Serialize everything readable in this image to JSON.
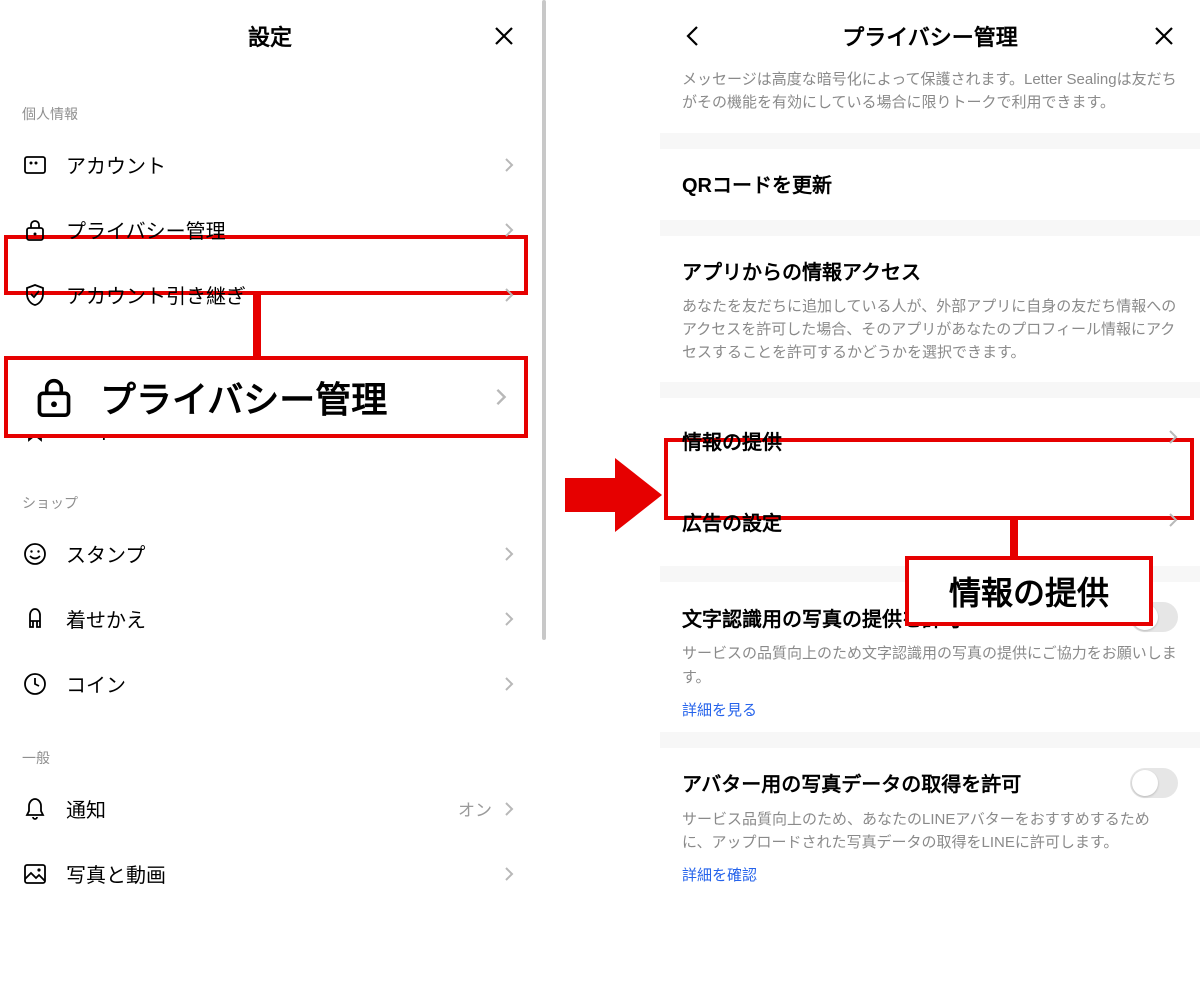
{
  "left": {
    "title": "設定",
    "sections": [
      {
        "label": "個人情報",
        "items": [
          {
            "icon": "account",
            "label": "アカウント"
          },
          {
            "icon": "lock",
            "label": "プライバシー管理"
          },
          {
            "icon": "shield",
            "label": "アカウント引き継ぎ"
          }
        ]
      }
    ],
    "callout": "プライバシー管理",
    "keep_label": "Keep",
    "shop_section": "ショップ",
    "shop_items": [
      {
        "icon": "smiley",
        "label": "スタンプ"
      },
      {
        "icon": "theme",
        "label": "着せかえ"
      },
      {
        "icon": "coin",
        "label": "コイン"
      }
    ],
    "general_section": "一般",
    "general_items": [
      {
        "icon": "bell",
        "label": "通知",
        "value": "オン"
      },
      {
        "icon": "photo",
        "label": "写真と動画"
      }
    ]
  },
  "right": {
    "title": "プライバシー管理",
    "top_desc": "メッセージは高度な暗号化によって保護されます。Letter Sealingは友だちがその機能を有効にしている場合に限りトークで利用できます。",
    "qr_label": "QRコードを更新",
    "app_access": {
      "label": "アプリからの情報アクセス",
      "desc": "あなたを友だちに追加している人が、外部アプリに自身の友だち情報へのアクセスを許可した場合、そのアプリがあなたのプロフィール情報にアクセスすることを許可するかどうかを選択できます。"
    },
    "info_provision": "情報の提供",
    "ad_settings": "広告の設定",
    "callout": "情報の提供",
    "ocr": {
      "label": "文字認識用の写真の提供を許可",
      "desc": "サービスの品質向上のため文字認識用の写真の提供にご協力をお願いします。",
      "link": "詳細を見る"
    },
    "avatar": {
      "label": "アバター用の写真データの取得を許可",
      "desc": "サービス品質向上のため、あなたのLINEアバターをおすすめするために、アップロードされた写真データの取得をLINEに許可します。",
      "link": "詳細を確認"
    }
  }
}
